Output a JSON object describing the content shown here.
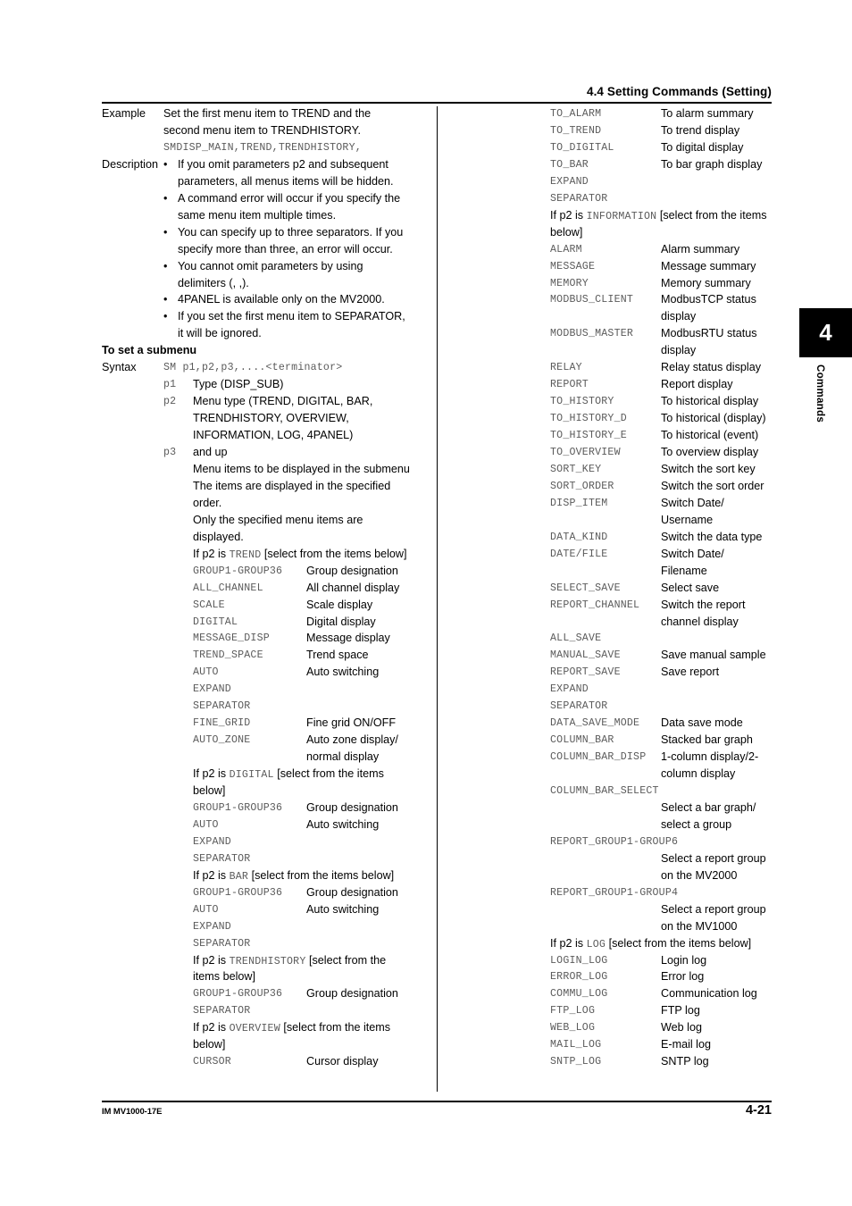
{
  "header": {
    "section_title": "4.4  Setting Commands (Setting)"
  },
  "chapter_tab": {
    "number": "4",
    "label": "Commands"
  },
  "footer": {
    "manual_id": "IM MV1000-17E",
    "page_number": "4-21"
  },
  "left_column": {
    "example": {
      "label": "Example",
      "lines": [
        "Set the first menu item to TREND and the",
        "second menu item to TRENDHISTORY."
      ],
      "code": "SMDISP_MAIN,TREND,TRENDHISTORY,"
    },
    "description": {
      "label": "Description",
      "bullets": [
        [
          "If you omit parameters p2 and subsequent",
          "parameters, all menus items will be hidden."
        ],
        [
          "A command error will occur if you specify the",
          "same menu item multiple times."
        ],
        [
          "You can specify up to three separators. If you",
          "specify more than three, an error will occur."
        ],
        [
          "You cannot omit parameters by using",
          "delimiters (, ,)."
        ],
        [
          "4PANEL is available only on the MV2000."
        ],
        [
          "If you set the first menu item to SEPARATOR,",
          "it will be ignored."
        ]
      ]
    },
    "submenu_heading": "To set a submenu",
    "syntax": {
      "label": "Syntax",
      "command": "SM p1,p2,p3,....<terminator>",
      "params": [
        {
          "name": "p1",
          "text": "Type (DISP_SUB)"
        },
        {
          "name": "p2",
          "text_lines": [
            "Menu type (TREND, DIGITAL, BAR,",
            "TRENDHISTORY, OVERVIEW,",
            "INFORMATION, LOG, 4PANEL)"
          ]
        },
        {
          "name": "p3",
          "text": "and up"
        }
      ],
      "notes": [
        "Menu items to be displayed in the submenu",
        "The items are displayed in the specified",
        "order.",
        "Only the specified menu items are",
        "displayed."
      ]
    },
    "groups": [
      {
        "condition_prefix": "If p2 is ",
        "condition_code": "TREND",
        "condition_suffix": " [select from the items below]",
        "condition_wrap": null,
        "items": [
          {
            "code": "GROUP1-GROUP36",
            "desc": "Group designation"
          },
          {
            "code": "ALL_CHANNEL",
            "desc": "All channel display"
          },
          {
            "code": "SCALE",
            "desc": "Scale display"
          },
          {
            "code": "DIGITAL",
            "desc": "Digital display"
          },
          {
            "code": "MESSAGE_DISP",
            "desc": "Message display"
          },
          {
            "code": "TREND_SPACE",
            "desc": "Trend space"
          },
          {
            "code": "AUTO",
            "desc": "Auto switching"
          },
          {
            "code": "EXPAND",
            "desc": ""
          },
          {
            "code": "SEPARATOR",
            "desc": ""
          },
          {
            "code": "FINE_GRID",
            "desc": "Fine grid ON/OFF"
          },
          {
            "code": "AUTO_ZONE",
            "desc": "Auto zone display/",
            "desc2": "normal display"
          }
        ]
      },
      {
        "condition_prefix": "If p2 is ",
        "condition_code": "DIGITAL",
        "condition_suffix": " [select from the items",
        "condition_wrap": "below]",
        "items": [
          {
            "code": "GROUP1-GROUP36",
            "desc": "Group designation"
          },
          {
            "code": "AUTO",
            "desc": "Auto switching"
          },
          {
            "code": "EXPAND",
            "desc": ""
          },
          {
            "code": "SEPARATOR",
            "desc": ""
          }
        ]
      },
      {
        "condition_prefix": "If p2 is ",
        "condition_code": "BAR",
        "condition_suffix": " [select from the items below]",
        "condition_wrap": null,
        "items": [
          {
            "code": "GROUP1-GROUP36",
            "desc": "Group designation"
          },
          {
            "code": "AUTO",
            "desc": "Auto switching"
          },
          {
            "code": "EXPAND",
            "desc": ""
          },
          {
            "code": "SEPARATOR",
            "desc": ""
          }
        ]
      },
      {
        "condition_prefix": "If p2 is ",
        "condition_code": "TRENDHISTORY",
        "condition_suffix": " [select from the",
        "condition_wrap": "items below]",
        "items": [
          {
            "code": "GROUP1-GROUP36",
            "desc": "Group designation"
          },
          {
            "code": "SEPARATOR",
            "desc": ""
          }
        ]
      },
      {
        "condition_prefix": "If p2 is ",
        "condition_code": "OVERVIEW",
        "condition_suffix": " [select from the items",
        "condition_wrap": "below]",
        "items": [
          {
            "code": "CURSOR",
            "desc": "Cursor display"
          }
        ]
      }
    ]
  },
  "right_column": {
    "overview_items_cont": [
      {
        "code": "TO_ALARM",
        "desc": "To alarm summary"
      },
      {
        "code": "TO_TREND",
        "desc": "To trend display"
      },
      {
        "code": "TO_DIGITAL",
        "desc": "To digital display"
      },
      {
        "code": "TO_BAR",
        "desc": "To bar graph display"
      },
      {
        "code": "EXPAND",
        "desc": ""
      },
      {
        "code": "SEPARATOR",
        "desc": ""
      }
    ],
    "groups": [
      {
        "condition_prefix": "If p2 is ",
        "condition_code": "INFORMATION",
        "condition_suffix": " [select from the items",
        "condition_wrap": "below]",
        "items": [
          {
            "code": "ALARM",
            "desc": "Alarm summary"
          },
          {
            "code": "MESSAGE",
            "desc": "Message summary"
          },
          {
            "code": "MEMORY",
            "desc": "Memory summary"
          },
          {
            "code": "MODBUS_CLIENT",
            "desc": "ModbusTCP status",
            "desc2": "display"
          },
          {
            "code": "MODBUS_MASTER",
            "desc": "ModbusRTU status",
            "desc2": "display"
          },
          {
            "code": "RELAY",
            "desc": "Relay status display"
          },
          {
            "code": "REPORT",
            "desc": "Report display"
          },
          {
            "code": "TO_HISTORY",
            "desc": "To historical display"
          },
          {
            "code": "TO_HISTORY_D",
            "desc": "To historical (display)"
          },
          {
            "code": "TO_HISTORY_E",
            "desc": "To historical (event)"
          },
          {
            "code": "TO_OVERVIEW",
            "desc": "To overview display"
          },
          {
            "code": "SORT_KEY",
            "desc": "Switch the sort key"
          },
          {
            "code": "SORT_ORDER",
            "desc": "Switch the sort order"
          },
          {
            "code": "DISP_ITEM",
            "desc": "Switch Date/",
            "desc2": "Username"
          },
          {
            "code": "DATA_KIND",
            "desc": "Switch the data type"
          },
          {
            "code": "DATE/FILE",
            "desc": "Switch Date/",
            "desc2": "Filename"
          },
          {
            "code": "SELECT_SAVE",
            "desc": "Select save"
          },
          {
            "code": "REPORT_CHANNEL",
            "desc": "Switch the report",
            "desc2": "channel display"
          },
          {
            "code": "ALL_SAVE",
            "desc": ""
          },
          {
            "code": "MANUAL_SAVE",
            "desc": "Save manual sample"
          },
          {
            "code": "REPORT_SAVE",
            "desc": "Save report"
          },
          {
            "code": "EXPAND",
            "desc": ""
          },
          {
            "code": "SEPARATOR",
            "desc": ""
          },
          {
            "code": "DATA_SAVE_MODE",
            "desc": "Data save mode"
          },
          {
            "code": "COLUMN_BAR",
            "desc": "Stacked bar graph"
          },
          {
            "code": "COLUMN_BAR_DISP",
            "desc": "1-column display/2-",
            "desc2": "column display"
          },
          {
            "code": "COLUMN_BAR_SELECT",
            "desc_below": "Select a bar graph/",
            "desc_below2": "select a group"
          },
          {
            "code": "REPORT_GROUP1-GROUP6",
            "desc_below": "Select a report group",
            "desc_below2": "on the MV2000"
          },
          {
            "code": "REPORT_GROUP1-GROUP4",
            "desc_below": "Select a report group",
            "desc_below2": "on the MV1000"
          }
        ]
      },
      {
        "condition_prefix": "If p2 is ",
        "condition_code": "LOG",
        "condition_suffix": " [select from the items below]",
        "condition_wrap": null,
        "items": [
          {
            "code": "LOGIN_LOG",
            "desc": "Login log"
          },
          {
            "code": "ERROR_LOG",
            "desc": "Error log"
          },
          {
            "code": "COMMU_LOG",
            "desc": "Communication log"
          },
          {
            "code": "FTP_LOG",
            "desc": "FTP log"
          },
          {
            "code": "WEB_LOG",
            "desc": "Web log"
          },
          {
            "code": "MAIL_LOG",
            "desc": "E-mail log"
          },
          {
            "code": "SNTP_LOG",
            "desc": "SNTP log"
          }
        ]
      }
    ]
  }
}
